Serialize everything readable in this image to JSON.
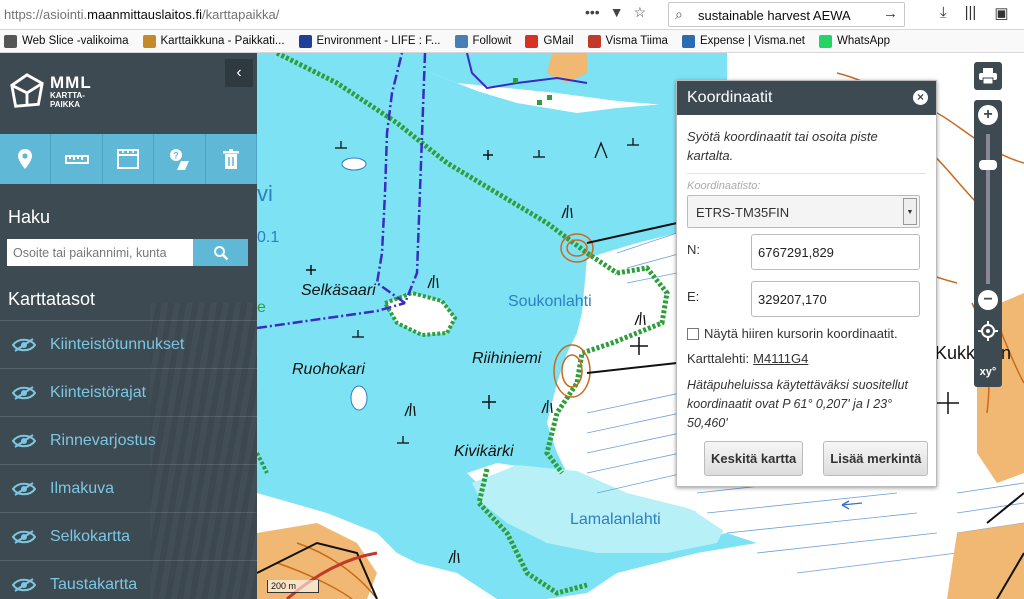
{
  "browser": {
    "url_prefix": "https://asiointi.",
    "url_domain": "maanmittauslaitos.fi",
    "url_path": "/karttapaikka/",
    "search_text": "sustainable harvest AEWA",
    "bookmarks": [
      {
        "label": "Web Slice -valikoima",
        "icon_color": "#555555"
      },
      {
        "label": "Karttaikkuna - Paikkati...",
        "icon_color": "#c48a2a"
      },
      {
        "label": "Environment - LIFE : F...",
        "icon_color": "#1f3f99"
      },
      {
        "label": "Followit",
        "icon_color": "#4a7fb5"
      },
      {
        "label": "GMail",
        "icon_color": "#d93025"
      },
      {
        "label": "Visma Tiima",
        "icon_color": "#c0392b"
      },
      {
        "label": "Expense | Visma.net",
        "icon_color": "#2c6ab1"
      },
      {
        "label": "WhatsApp",
        "icon_color": "#25d366"
      }
    ]
  },
  "sidebar": {
    "logo_line1": "MML",
    "logo_line2": "KARTTA-",
    "logo_line3": "PAIKKA",
    "search_title": "Haku",
    "search_placeholder": "Osoite tai paikannimi, kunta",
    "layers_title": "Karttatasot",
    "layers": [
      {
        "label": "Kiinteistötunnukset"
      },
      {
        "label": "Kiinteistörajat"
      },
      {
        "label": "Rinnevarjostus"
      },
      {
        "label": "Ilmakuva"
      },
      {
        "label": "Selkokartta"
      },
      {
        "label": "Taustakartta"
      }
    ]
  },
  "map": {
    "labels": {
      "selkasaari": "Selkäsaari",
      "ruohokari": "Ruohokari",
      "riihiniemi": "Riihiniemi",
      "kivikarki": "Kivikärki",
      "kukkura": "Kukkuran",
      "fragment_vi": "vi",
      "fragment_01": "0.1",
      "fragment_e": "e"
    },
    "water_labels": {
      "soukonlahti": "Soukonlahti",
      "lamalanlahti": "Lamalanlahti"
    },
    "scale": "200 m",
    "xy_label": "xy°"
  },
  "popup": {
    "title": "Koordinaatit",
    "description": "Syötä koordinaatit tai osoita piste kartalta.",
    "system_label": "Koordinaatisto:",
    "system_value": "ETRS-TM35FIN",
    "n_label": "N:",
    "n_value": "6767291,829",
    "e_label": "E:",
    "e_value": "329207,170",
    "checkbox_label": "Näytä hiiren kursorin koordinaatit.",
    "sheet_label": "Karttalehti:",
    "sheet_value": "M4111G4",
    "note": "Hätäpuheluissa käytettäväksi suositellut koordinaatit ovat P 61° 0,207' ja I 23° 50,460'",
    "center_button": "Keskitä kartta",
    "add_button": "Lisää merkintä"
  },
  "colors": {
    "sidebar_bg": "#3e4a52",
    "accent": "#5fb8d6",
    "water": "#7de3f4",
    "water_light": "#b8f0f7",
    "land_sand": "#f0b872",
    "shore_green": "#2e9e3a",
    "boundary_purple": "#3a2bc4"
  }
}
